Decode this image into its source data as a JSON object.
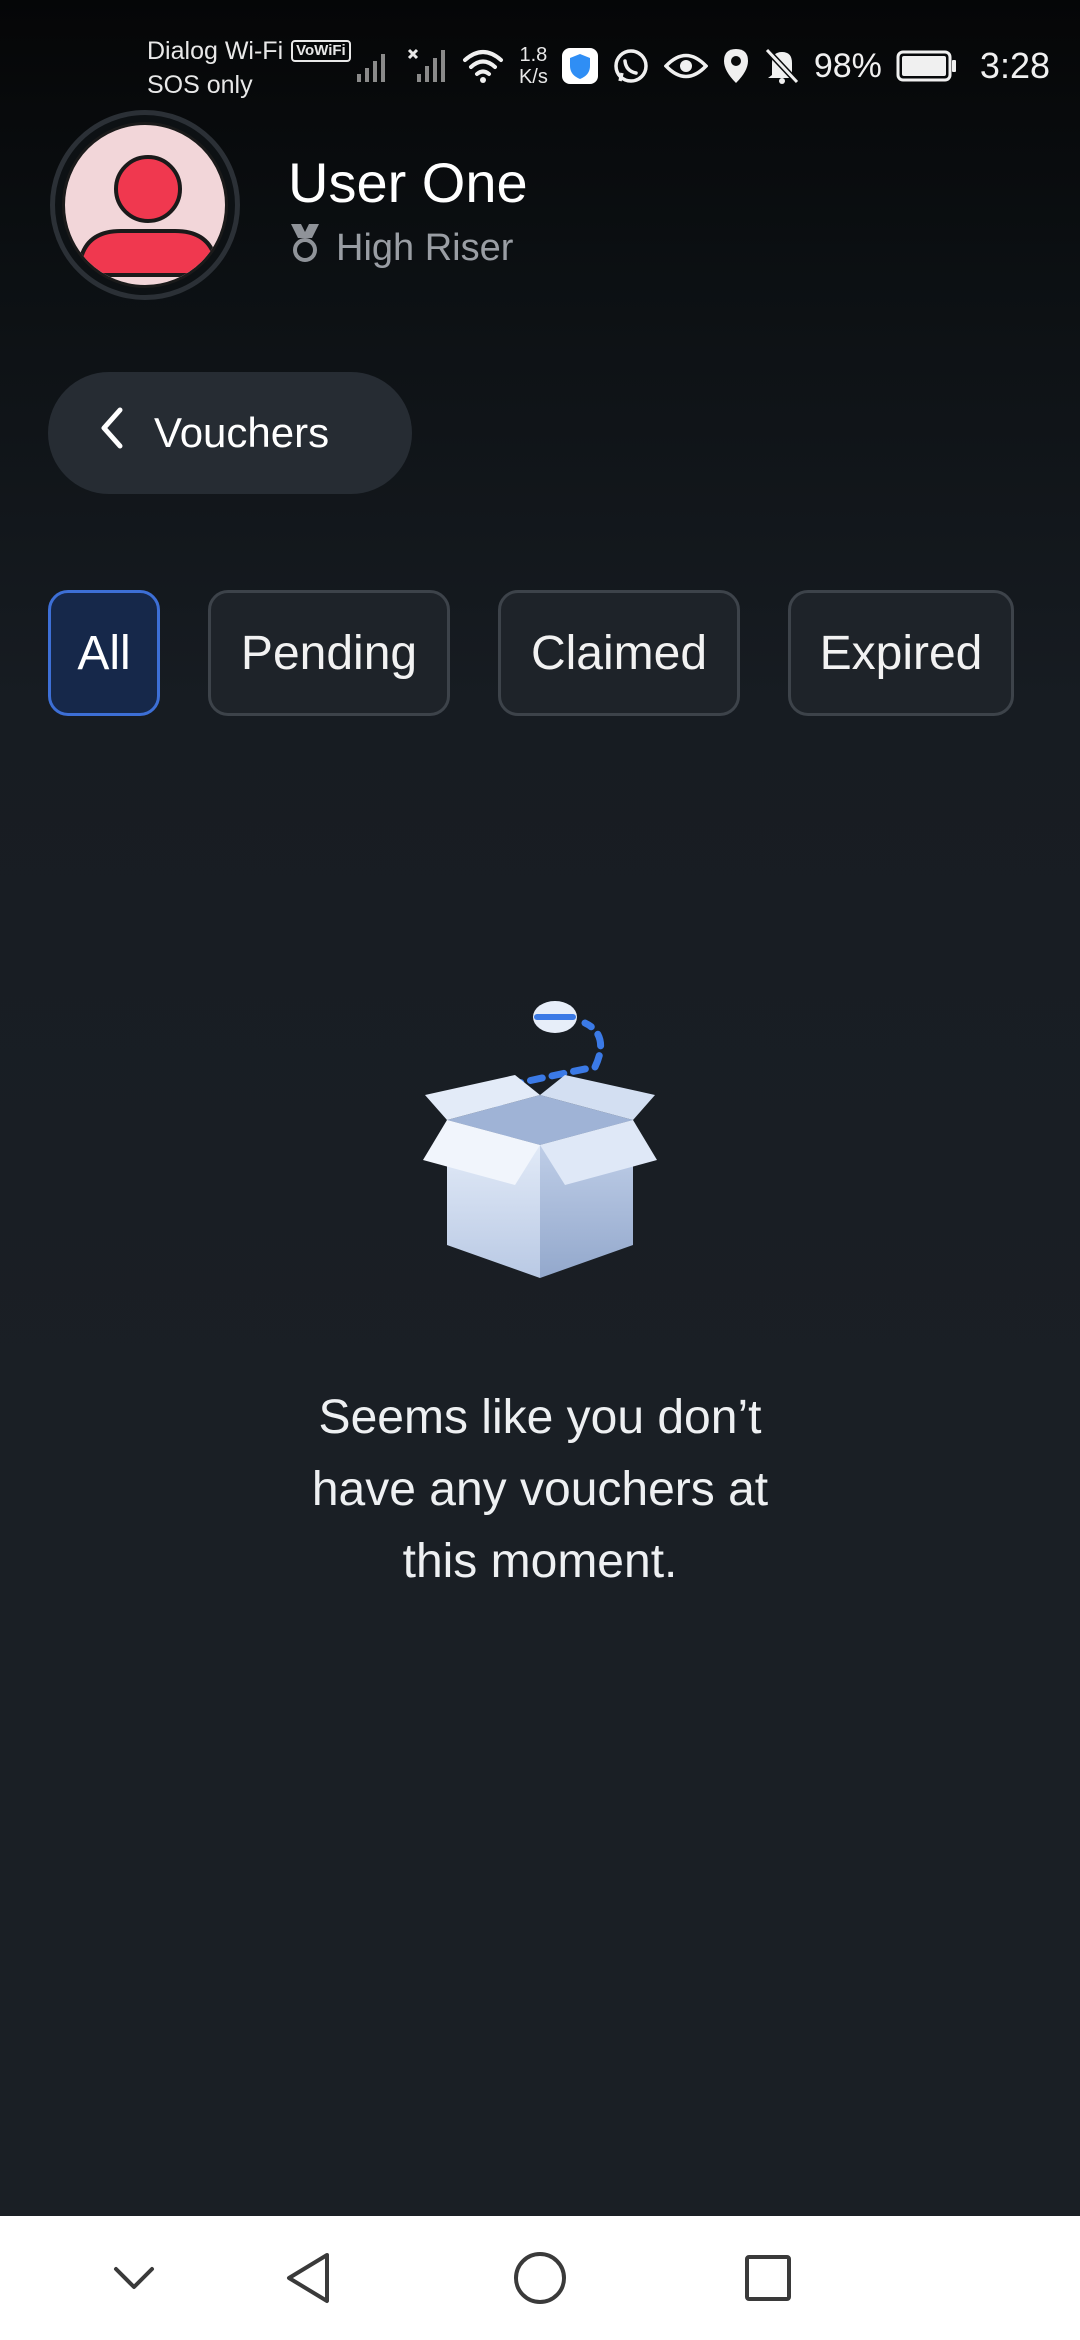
{
  "status_bar": {
    "carrier": "Dialog Wi-Fi",
    "vowifi_badge": "VoWiFi",
    "sos": "SOS only",
    "speed_value": "1.8",
    "speed_unit": "K/s",
    "battery": "98%",
    "time": "3:28"
  },
  "profile": {
    "name": "User One",
    "rank": "High Riser"
  },
  "header": {
    "back_label": "Vouchers"
  },
  "tabs": [
    {
      "label": "All",
      "active": true
    },
    {
      "label": "Pending",
      "active": false
    },
    {
      "label": "Claimed",
      "active": false
    },
    {
      "label": "Expired",
      "active": false
    }
  ],
  "empty_state": {
    "line1": "Seems like you don’t",
    "line2": "have any vouchers at",
    "line3": "this moment."
  },
  "colors": {
    "accent": "#3d6fd6",
    "avatar": "#f0384f",
    "illustration_dash": "#3b7ae6"
  }
}
